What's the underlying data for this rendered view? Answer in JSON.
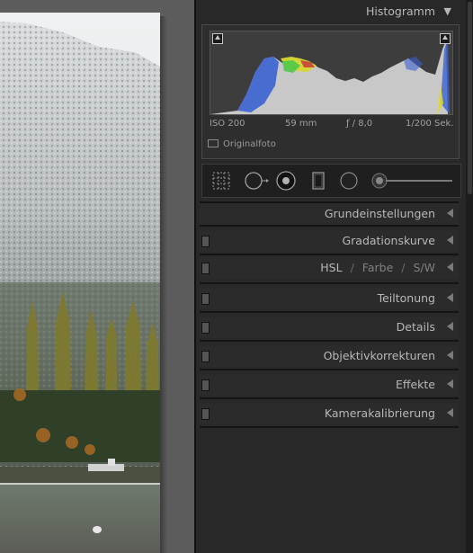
{
  "histogram": {
    "title": "Histogramm",
    "iso": "ISO 200",
    "focal": "59 mm",
    "aperture": "ƒ / 8,0",
    "shutter": "1/200 Sek.",
    "original_photo": "Originalfoto"
  },
  "sections": {
    "grundeinstellungen": "Grundeinstellungen",
    "gradationskurve": "Gradationskurve",
    "hsl": "HSL",
    "farbe": "Farbe",
    "sw": "S/W",
    "separator": "/",
    "teiltonung": "Teiltonung",
    "details": "Details",
    "objektivkorrekturen": "Objektivkorrekturen",
    "effekte": "Effekte",
    "kamerakalibrierung": "Kamerakalibrierung"
  },
  "tools": [
    "crop-overlay-icon",
    "spot-removal-icon",
    "red-eye-icon",
    "graduated-filter-icon",
    "radial-filter-icon",
    "adjustment-brush-slider"
  ]
}
